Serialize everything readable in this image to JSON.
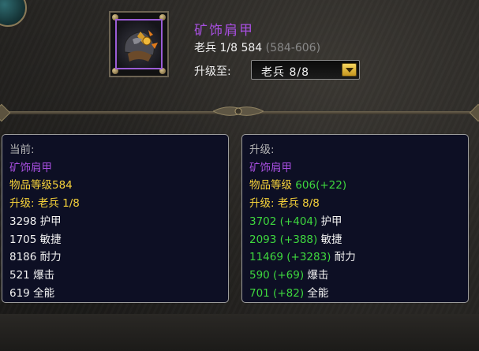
{
  "item": {
    "name": "矿饰肩甲",
    "level_label": "老兵 1/8",
    "item_level": "584",
    "level_range": "(584-606)",
    "upgrade_label": "升级至:",
    "upgrade_selected": "老兵 8/8",
    "icon": "shoulder-armor-icon",
    "icon_border_color": "#9b5cd6"
  },
  "current": {
    "header": "当前:",
    "name": "矿饰肩甲",
    "item_level_text": "物品等级584",
    "upgrade_text": "升级: 老兵 1/8",
    "stats": [
      {
        "value": "3298",
        "label": "护甲"
      },
      {
        "value": "1705",
        "label": "敏捷"
      },
      {
        "value": "8186",
        "label": "耐力"
      },
      {
        "value": "521",
        "label": "爆击"
      },
      {
        "value": "619",
        "label": "全能"
      }
    ]
  },
  "upgraded": {
    "header": "升级:",
    "name": "矿饰肩甲",
    "item_level_label": "物品等级",
    "item_level_value": "606(+22)",
    "upgrade_text": "升级: 老兵 8/8",
    "stats": [
      {
        "value": "3702 (+404)",
        "label": "护甲"
      },
      {
        "value": "2093 (+388)",
        "label": "敏捷"
      },
      {
        "value": "11469 (+3283)",
        "label": "耐力"
      },
      {
        "value": "590 (+69)",
        "label": "爆击"
      },
      {
        "value": "701 (+82)",
        "label": "全能"
      }
    ]
  },
  "colors": {
    "epic_purple": "#a84fe0",
    "upgrade_yellow": "#f6d23a",
    "gain_green": "#3ed83e",
    "panel_bg": "#0d0f24"
  }
}
